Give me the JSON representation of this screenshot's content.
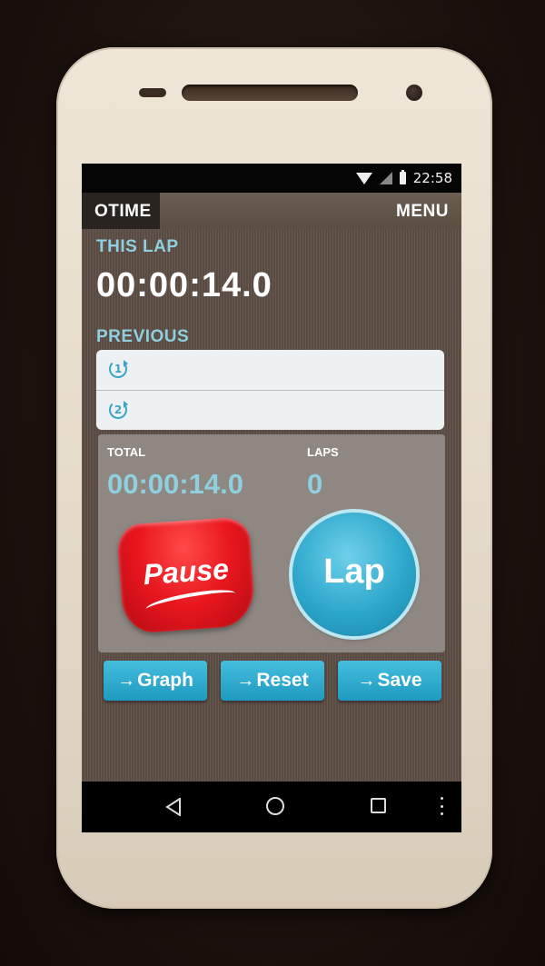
{
  "status_bar": {
    "time": "22:58"
  },
  "app_bar": {
    "logo": "OTIME",
    "menu": "MENU"
  },
  "this_lap": {
    "label": "THIS LAP",
    "time": "00:00:14.0"
  },
  "previous": {
    "label": "PREVIOUS",
    "rows": [
      {
        "number": "1",
        "value": ""
      },
      {
        "number": "2",
        "value": ""
      }
    ]
  },
  "stats": {
    "total_label": "TOTAL",
    "total_value": "00:00:14.0",
    "laps_label": "LAPS",
    "laps_value": "0"
  },
  "controls": {
    "pause": "Pause",
    "lap": "Lap"
  },
  "actions": {
    "graph": "Graph",
    "reset": "Reset",
    "save": "Save",
    "arrow": "→"
  },
  "colors": {
    "accent_blue": "#2ca7cb",
    "label_blue": "#8fcfe0",
    "pause_red": "#e8161e"
  },
  "icons": {
    "wifi": "wifi-icon",
    "signal": "signal-icon",
    "battery": "battery-icon",
    "lap_history": "lap-history-icon",
    "back": "back-icon",
    "home": "home-icon",
    "recents": "recents-icon",
    "overflow": "overflow-menu-icon"
  }
}
